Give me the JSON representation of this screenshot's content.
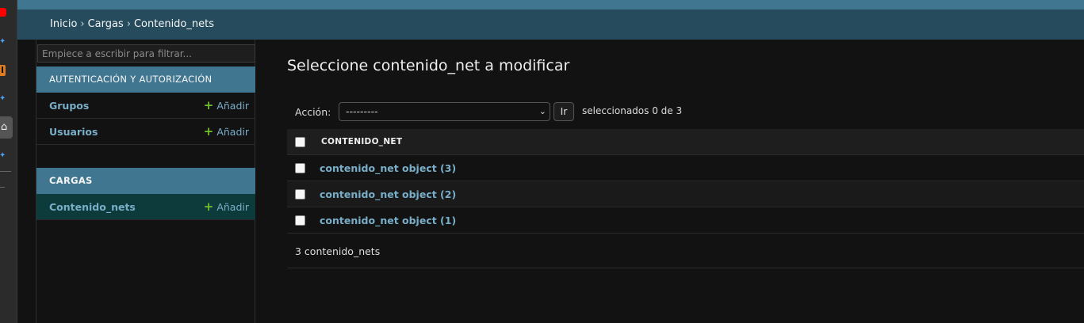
{
  "browser_strip": {
    "icons": [
      "youtube-icon",
      "bookmark-icon",
      "i-icon",
      "bookmark-icon",
      "home-icon",
      "bookmark-icon"
    ]
  },
  "breadcrumbs": {
    "home": "Inicio",
    "app": "Cargas",
    "current": "Contenido_nets",
    "separator": "›"
  },
  "sidebar": {
    "filter_placeholder": "Empiece a escribir para filtrar...",
    "modules": [
      {
        "caption": "AUTENTICACIÓN Y AUTORIZACIÓN",
        "models": [
          {
            "name": "Grupos",
            "add_label": "Añadir"
          },
          {
            "name": "Usuarios",
            "add_label": "Añadir"
          }
        ]
      },
      {
        "caption": "CARGAS",
        "models": [
          {
            "name": "Contenido_nets",
            "add_label": "Añadir"
          }
        ]
      }
    ]
  },
  "main": {
    "title": "Seleccione contenido_net a modificar",
    "actions": {
      "label": "Acción:",
      "selected_value": "---------",
      "go_label": "Ir",
      "counter": "seleccionados 0 de 3"
    },
    "table": {
      "column_header": "CONTENIDO_NET",
      "rows": [
        "contenido_net object (3)",
        "contenido_net object (2)",
        "contenido_net object (1)"
      ]
    },
    "paginator": "3 contenido_nets"
  },
  "colors": {
    "header": "#417690",
    "breadcrumbs_bg": "#264b5d",
    "link": "#79aec8",
    "add_plus": "#70bf2b",
    "background": "#121212"
  }
}
